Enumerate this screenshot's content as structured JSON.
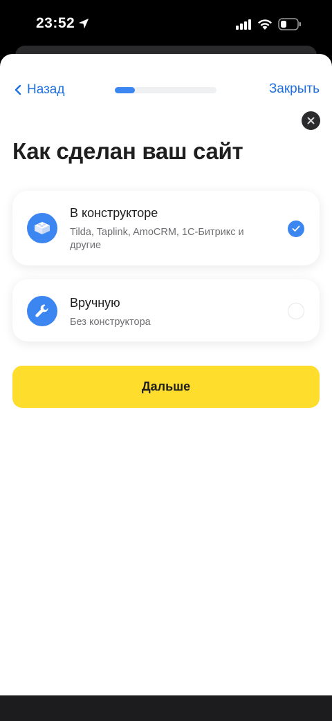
{
  "status_bar": {
    "time": "23:52",
    "icons": [
      "location-arrow-icon",
      "signal-icon",
      "wifi-icon",
      "battery-icon"
    ]
  },
  "nav": {
    "back_label": "Назад",
    "close_label": "Закрыть",
    "progress_fraction": 0.2
  },
  "title": "Как сделан ваш сайт",
  "options": [
    {
      "title": "В конструкторе",
      "subtitle": "Tilda, Taplink, AmoCRM, 1С-Битрикс и другие",
      "icon": "brick-icon",
      "selected": true
    },
    {
      "title": "Вручную",
      "subtitle": "Без конструктора",
      "icon": "wrench-icon",
      "selected": false
    }
  ],
  "next_button_label": "Дальше",
  "colors": {
    "accent": "#3c86f2",
    "link": "#1d6fe0",
    "primary_button": "#ffdd2d",
    "text": "#1f1f1f",
    "muted_text": "#6f6f73"
  }
}
